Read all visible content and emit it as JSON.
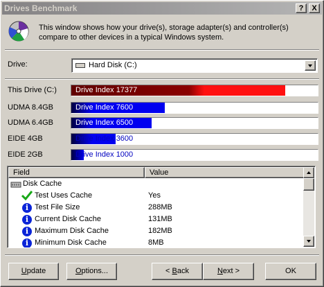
{
  "window": {
    "title": "Drives Benchmark",
    "help_btn": "?",
    "close_btn": "X"
  },
  "header": {
    "description": "This window shows how your drive(s), storage adapter(s) and controller(s) compare to other devices in a typical Windows system."
  },
  "drive_select": {
    "label": "Drive:",
    "selected": "Hard Disk (C:)"
  },
  "benchmarks": [
    {
      "name": "This Drive (C:)",
      "label": "Drive Index 17377",
      "value": 17377,
      "color": "#ff1010"
    },
    {
      "name": "UDMA 8.4GB",
      "label": "Drive Index 7600",
      "value": 7600,
      "color": "#0000f0"
    },
    {
      "name": "UDMA 6.4GB",
      "label": "Drive Index 6500",
      "value": 6500,
      "color": "#0000f0"
    },
    {
      "name": "EIDE 4GB",
      "label": "Drive Index 3600",
      "value": 3600,
      "color": "#0000f0"
    },
    {
      "name": "EIDE 2GB",
      "label": "Drive Index 1000",
      "value": 1000,
      "color": "#0000f0"
    }
  ],
  "details": {
    "columns": {
      "field": "Field",
      "value": "Value"
    },
    "group": "Disk Cache",
    "rows": [
      {
        "field": "Test Uses Cache",
        "value": "Yes",
        "icon": "check-icon"
      },
      {
        "field": "Test File Size",
        "value": "288MB",
        "icon": "info-icon"
      },
      {
        "field": "Current Disk Cache",
        "value": "131MB",
        "icon": "info-icon"
      },
      {
        "field": "Maximum Disk Cache",
        "value": "182MB",
        "icon": "info-icon"
      },
      {
        "field": "Minimum Disk Cache",
        "value": "8MB",
        "icon": "info-icon"
      }
    ]
  },
  "buttons": {
    "update": {
      "pre": "",
      "u": "U",
      "post": "pdate"
    },
    "options": {
      "pre": "",
      "u": "O",
      "post": "ptions..."
    },
    "back": {
      "pre": "< ",
      "u": "B",
      "post": "ack"
    },
    "next": {
      "pre": "",
      "u": "N",
      "post": "ext >"
    },
    "ok": {
      "label": "OK"
    }
  }
}
